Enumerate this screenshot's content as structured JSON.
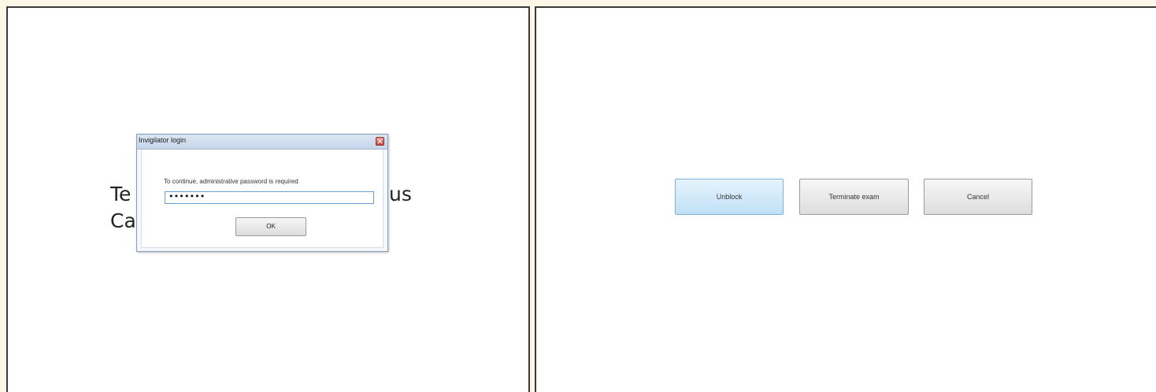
{
  "background_text": {
    "line1_start": "Te",
    "line1_end": "us",
    "line2_start": "Ca"
  },
  "dialog": {
    "title": "Invigilator login",
    "close_icon": "close-icon",
    "message": "To continue, administrative password is required",
    "password_value": "•••••••",
    "ok_label": "OK"
  },
  "actions": {
    "unblock_label": "Unblock",
    "terminate_label": "Terminate exam",
    "cancel_label": "Cancel"
  },
  "colors": {
    "page_background": "#fdf7e8",
    "panel_border": "#3a3a3a",
    "unblock_accent": "#bfe0f6",
    "close_button": "#c7473a"
  }
}
